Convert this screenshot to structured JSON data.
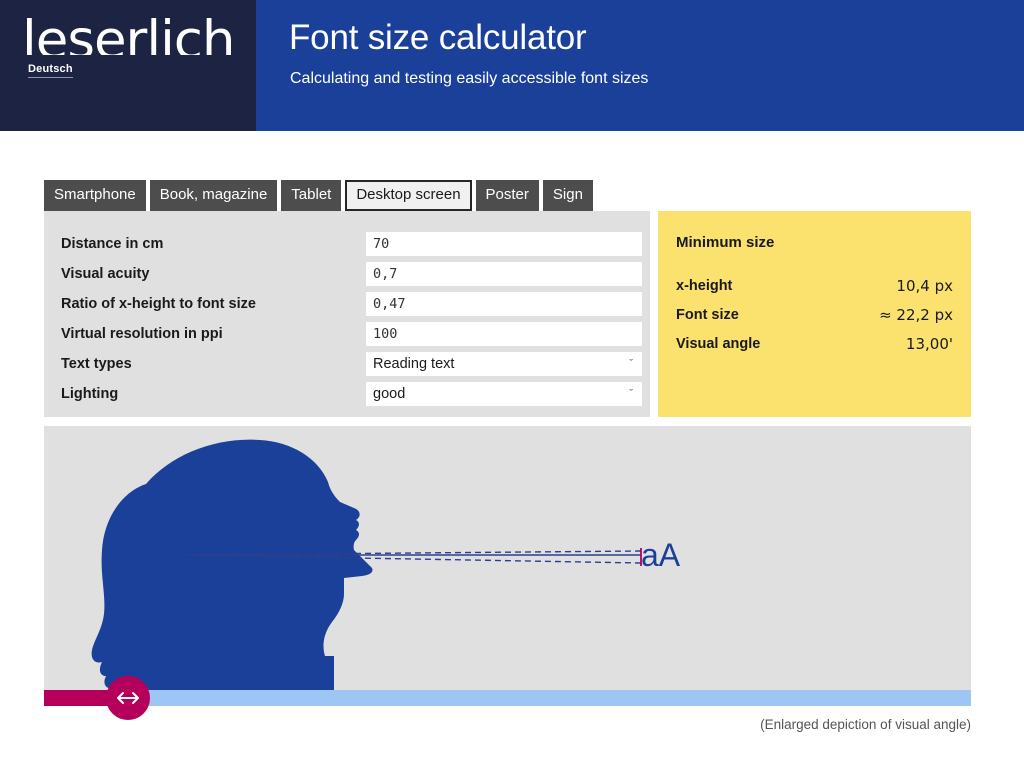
{
  "header": {
    "logo_text": "leserlich",
    "language_link": "Deutsch",
    "title": "Font size calculator",
    "subtitle": "Calculating and testing easily accessible font sizes",
    "logo_bg": "#1d2342",
    "title_bg": "#1b409a"
  },
  "tabs": [
    {
      "label": "Smartphone",
      "active": false
    },
    {
      "label": "Book, magazine",
      "active": false
    },
    {
      "label": "Tablet",
      "active": false
    },
    {
      "label": "Desktop screen",
      "active": true
    },
    {
      "label": "Poster",
      "active": false
    },
    {
      "label": "Sign",
      "active": false
    }
  ],
  "form": {
    "fields": [
      {
        "label": "Distance in cm",
        "value": "70",
        "type": "text"
      },
      {
        "label": "Visual acuity",
        "value": "0,7",
        "type": "text"
      },
      {
        "label": "Ratio of x-height to font size",
        "value": "0,47",
        "type": "text"
      },
      {
        "label": "Virtual resolution in ppi",
        "value": "100",
        "type": "text"
      },
      {
        "label": "Text types",
        "value": "Reading text",
        "type": "select"
      },
      {
        "label": "Lighting",
        "value": "good",
        "type": "select"
      }
    ],
    "caret_glyph": "ˇ"
  },
  "results": {
    "heading": "Minimum size",
    "accent_color": "#fbe26e",
    "rows": [
      {
        "name": "x-height",
        "value": "10,4 px"
      },
      {
        "name": "Font size",
        "value": "≈ 22,2 px"
      },
      {
        "name": "Visual angle",
        "value": "13,00'"
      }
    ]
  },
  "illustration": {
    "sample_text": "aA",
    "caption": "(Enlarged depiction of visual angle)",
    "head_color": "#1b409a",
    "sightline_color": "#2b3f8c",
    "marker_color": "#b4005a",
    "background": "#e0e0e0"
  },
  "slider": {
    "fill_color": "#b4005a",
    "track_color": "#9dc6f5",
    "handle_icon": "left-right-arrow"
  }
}
